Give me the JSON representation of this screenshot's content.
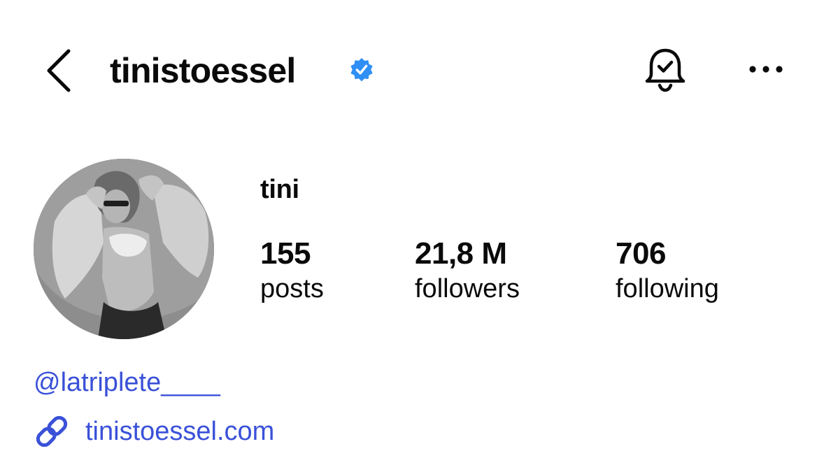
{
  "header": {
    "username": "tinistoessel",
    "verified_icon": "verified-badge-icon",
    "icons": {
      "back": "chevron-left-icon",
      "notifications": "bell-check-icon",
      "more": "more-horizontal-icon"
    }
  },
  "profile": {
    "display_name": "tini",
    "stats": {
      "posts": {
        "value": "155",
        "label": "posts"
      },
      "followers": {
        "value": "21,8 M",
        "label": "followers"
      },
      "following": {
        "value": "706",
        "label": "following"
      }
    }
  },
  "bio": {
    "mention": "@latriplete____",
    "link": {
      "icon": "link-icon",
      "text": "tinistoessel.com"
    }
  },
  "colors": {
    "text": "#0a0a0a",
    "link": "#3a51d8",
    "verified": "#2f8ff5",
    "background": "#ffffff"
  }
}
